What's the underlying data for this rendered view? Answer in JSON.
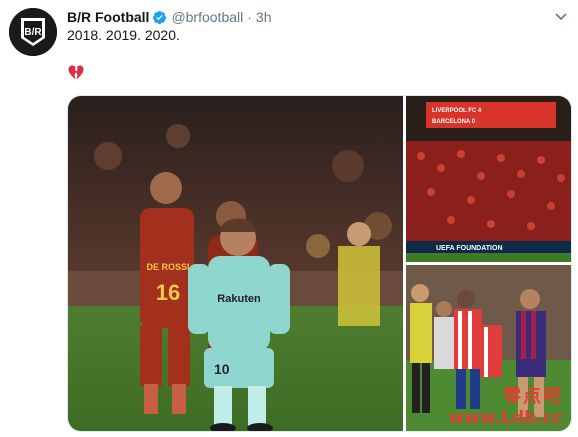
{
  "account": {
    "name": "B/R Football",
    "handle": "@brfootball",
    "separator": "·",
    "time": "3h",
    "avatar_text": "B/R",
    "verified": true
  },
  "tweet": {
    "text": "2018. 2019. 2020.",
    "emoji": "broken-heart-icon"
  },
  "media": {
    "main_photo": {
      "captions": [
        "DE ROSSI",
        "16",
        "Rakuten",
        "10"
      ]
    },
    "top_right_photo": {
      "scoreboard_rows": [
        "LIVERPOOL FC  4",
        "BARCELONA  0"
      ],
      "banner": "UEFA FOUNDATION"
    },
    "bottom_right_photo": {}
  },
  "watermark": {
    "text": "零点吧",
    "url": "www.Ldb.cc"
  },
  "colors": {
    "verified": "#1da1f2",
    "text_primary": "#14171a",
    "text_secondary": "#657786",
    "heart": "#e0245e",
    "watermark": "#e0402f"
  }
}
